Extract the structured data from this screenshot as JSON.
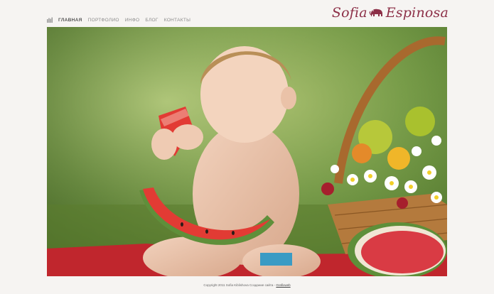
{
  "logo": {
    "part1": "Sofia",
    "part2": "Espinosa",
    "icon": "elephant-icon",
    "color": "#8c2f47"
  },
  "nav": {
    "home_icon": "home-icon",
    "items": [
      {
        "label": "ГЛАВНАЯ",
        "active": true
      },
      {
        "label": "ПОРТФОЛИО",
        "active": false
      },
      {
        "label": "ИНФО",
        "active": false
      },
      {
        "label": "БЛОГ",
        "active": false
      },
      {
        "label": "КОНТАКТЫ",
        "active": false
      }
    ]
  },
  "hero": {
    "subject": "child-with-watermelon-photo"
  },
  "footer": {
    "text": "Copyright 2011 Sofia Kiblishova Создание сайта -",
    "link": "Grafixweb"
  }
}
